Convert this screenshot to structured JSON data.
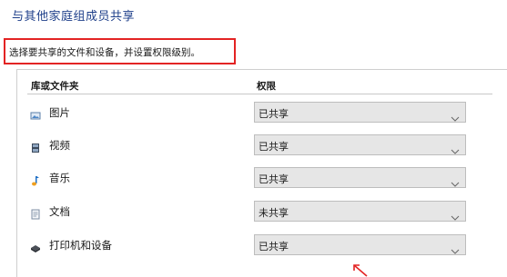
{
  "window": {
    "title": "与其他家庭组成员共享"
  },
  "instruction": "选择要共享的文件和设备，并设置权限级别。",
  "table": {
    "col_library": "库或文件夹",
    "col_permission": "权限",
    "rows": [
      {
        "label": "图片",
        "icon": "pictures-icon",
        "permission": "已共享"
      },
      {
        "label": "视频",
        "icon": "videos-icon",
        "permission": "已共享"
      },
      {
        "label": "音乐",
        "icon": "music-icon",
        "permission": "已共享"
      },
      {
        "label": "文档",
        "icon": "documents-icon",
        "permission": "未共享"
      },
      {
        "label": "打印机和设备",
        "icon": "printer-icon",
        "permission": "已共享"
      }
    ]
  },
  "colors": {
    "title": "#1e3f8a",
    "highlight_box": "#e32323",
    "annotation_arrow": "#e32323"
  }
}
